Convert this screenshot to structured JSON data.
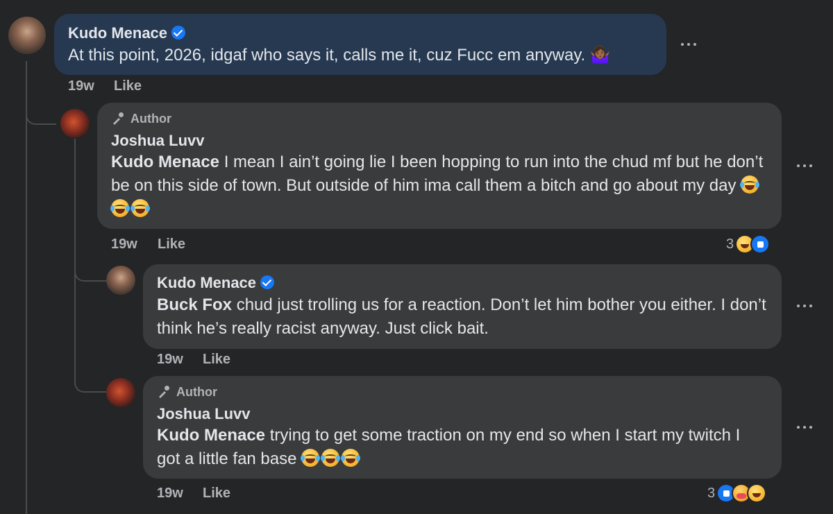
{
  "comments": [
    {
      "author": "Kudo Menace",
      "verified": true,
      "text": "At this point, 2026, idgaf who says it, calls me it, cuz Fucc em anyway. 🤷🏾‍♀️",
      "time": "19w",
      "like": "Like"
    },
    {
      "badge": "Author",
      "author": "Joshua Luvv",
      "mention": "Kudo Menace",
      "text": " I mean I ain’t going lie I been hopping to run into the chud mf but he don’t be on this side of town. But outside of him ima call them a bitch and go about my day",
      "time": "19w",
      "like": "Like",
      "reaction_count": "3",
      "reaction_icons": [
        "haha-icon",
        "like-icon"
      ]
    },
    {
      "author": "Kudo Menace",
      "verified": true,
      "mention": "Buck Fox",
      "text": " chud just trolling us for a reaction. Don’t let him bother you either. I don’t think he’s really racist anyway. Just click bait.",
      "time": "19w",
      "like": "Like"
    },
    {
      "badge": "Author",
      "author": "Joshua Luvv",
      "mention": "Kudo Menace",
      "text": " trying to get some traction on my end so when I start my twitch I got a little fan base",
      "time": "19w",
      "like": "Like",
      "reaction_count": "3",
      "reaction_icons": [
        "like-icon",
        "care-icon",
        "haha-icon"
      ]
    }
  ],
  "colors": {
    "background": "#242526",
    "highlight_bubble": "#263951",
    "reply_bubble": "#3a3b3c",
    "meta": "#b0b3b8",
    "verified": "#1877f2"
  }
}
